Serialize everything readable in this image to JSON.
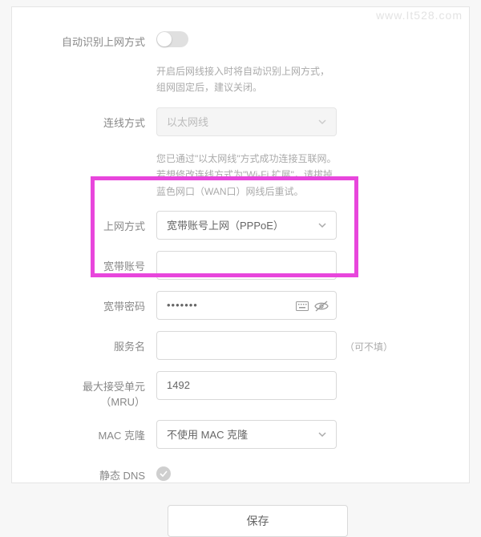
{
  "watermark": "www.It528.com",
  "auto_detect": {
    "label": "自动识别上网方式",
    "on": false,
    "note": "开启后网线接入时将自动识别上网方式，组网固定后，建议关闭。"
  },
  "conn_type": {
    "label": "连线方式",
    "value": "以太网线",
    "note": "您已通过\"以太网线\"方式成功连接互联网。若想修改连线方式为\"Wi-Fi 扩展\"，请拔掉蓝色网口（WAN口）网线后重试。"
  },
  "internet_mode": {
    "label": "上网方式",
    "value": "宽带账号上网（PPPoE）"
  },
  "account": {
    "label": "宽带账号",
    "value": ""
  },
  "password": {
    "label": "宽带密码",
    "value": "•••••••"
  },
  "service": {
    "label": "服务名",
    "value": "",
    "suffix": "（可不填）"
  },
  "mru": {
    "label": "最大接受单元（MRU）",
    "value": "1492"
  },
  "mac_clone": {
    "label": "MAC 克隆",
    "value": "不使用 MAC 克隆"
  },
  "static_dns": {
    "label": "静态 DNS",
    "on": true
  },
  "save_label": "保存"
}
